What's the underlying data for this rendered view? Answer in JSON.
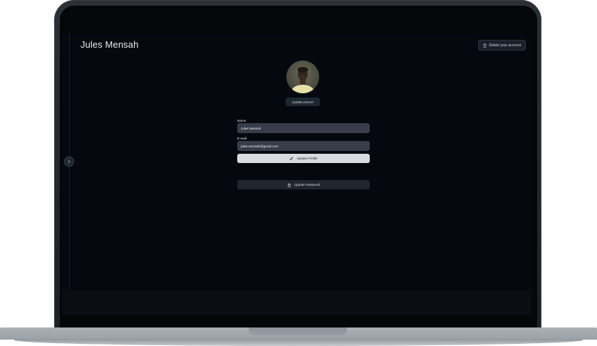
{
  "profile": {
    "name": "Jules Mensah",
    "update_picture_label": "Update picture"
  },
  "header": {
    "delete_account_label": "Delete your account",
    "delete_icon": "trash-icon"
  },
  "sidebar": {
    "toggle_icon": "chevron-right-icon"
  },
  "form": {
    "name_label": "Name",
    "name_value": "Jules Mensah",
    "email_label": "E-mail",
    "email_value": "jules.mensah@gmail.com",
    "update_profile_label": "Update Profile",
    "update_profile_icon": "pencil-icon",
    "update_password_label": "Update Password",
    "update_password_icon": "lock-icon"
  },
  "colors": {
    "screen_bg": "#05090f",
    "primary_button": "#d8dbe0",
    "secondary_button": "#1f2630",
    "input_bg": "#373e4a"
  }
}
